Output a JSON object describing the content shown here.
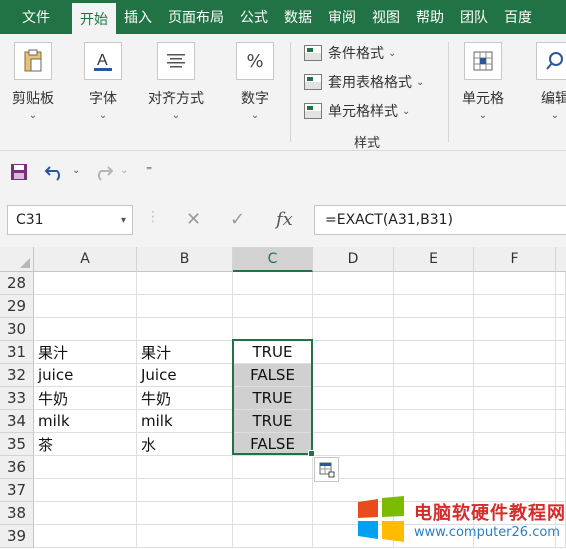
{
  "ribbon_tabs": [
    "文件",
    "开始",
    "插入",
    "页面布局",
    "公式",
    "数据",
    "审阅",
    "视图",
    "帮助",
    "团队",
    "百度"
  ],
  "active_tab_index": 1,
  "ribbon": {
    "clipboard": "剪贴板",
    "font": "字体",
    "alignment": "对齐方式",
    "number": "数字",
    "number_icon": "%",
    "conditional_format": "条件格式",
    "table_format": "套用表格格式",
    "cell_style": "单元格样式",
    "styles_group": "样式",
    "cells": "单元格",
    "edit": "编辑"
  },
  "formula_bar": {
    "name_box": "C31",
    "formula": "=EXACT(A31,B31)",
    "fx": "fx"
  },
  "columns": [
    "A",
    "B",
    "C",
    "D",
    "E",
    "F"
  ],
  "selected_column": "C",
  "rows": [
    {
      "num": "28",
      "a": "",
      "b": "",
      "c": ""
    },
    {
      "num": "29",
      "a": "",
      "b": "",
      "c": ""
    },
    {
      "num": "30",
      "a": "",
      "b": "",
      "c": ""
    },
    {
      "num": "31",
      "a": "果汁",
      "b": "果汁",
      "c": "TRUE"
    },
    {
      "num": "32",
      "a": "juice",
      "b": "Juice",
      "c": "FALSE"
    },
    {
      "num": "33",
      "a": "牛奶",
      "b": "牛奶",
      "c": "TRUE"
    },
    {
      "num": "34",
      "a": "milk",
      "b": "milk",
      "c": "TRUE"
    },
    {
      "num": "35",
      "a": "茶",
      "b": "水",
      "c": "FALSE"
    },
    {
      "num": "36",
      "a": "",
      "b": "",
      "c": ""
    },
    {
      "num": "37",
      "a": "",
      "b": "",
      "c": ""
    },
    {
      "num": "38",
      "a": "",
      "b": "",
      "c": ""
    },
    {
      "num": "39",
      "a": "",
      "b": "",
      "c": ""
    }
  ],
  "watermark": {
    "title": "电脑软硬件教程网",
    "url": "www.computer26.com"
  },
  "colors": {
    "accent": "#217346",
    "ribbon_bg": "#f3f3f3",
    "selection_fill": "#d0d0d0"
  }
}
